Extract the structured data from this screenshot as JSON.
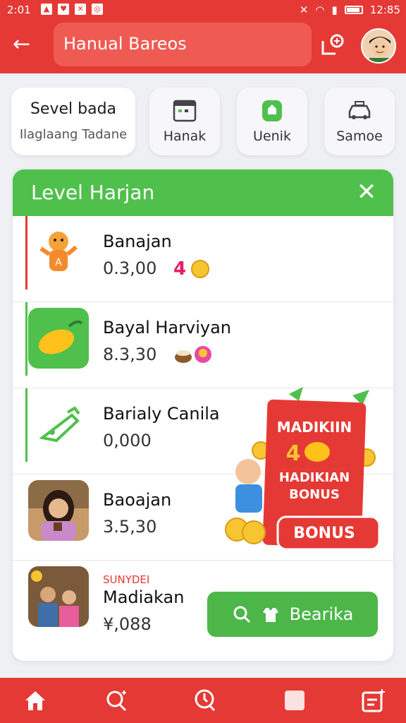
{
  "status": {
    "time_left": "2:01",
    "time_right": "12:85"
  },
  "header": {
    "search_text": "Hanual Bareos"
  },
  "categories": [
    {
      "title": "Sevel bada",
      "subtitle": "Ilaglaang Tadane"
    },
    {
      "label": "Hanak",
      "icon": "calendar-icon"
    },
    {
      "label": "Uenik",
      "icon": "shield-icon"
    },
    {
      "label": "Samoe",
      "icon": "taxi-icon"
    }
  ],
  "panel": {
    "title": "Level Harjan",
    "items": [
      {
        "name": "Banajan",
        "price": "0.3,00",
        "badge": "4",
        "accent": "#e53935"
      },
      {
        "name": "Bayal Harviyan",
        "price": "8.3,30",
        "accent": "#4fc04c"
      },
      {
        "name": "Barialy Canila",
        "price": "0,000",
        "accent": "#4fc04c"
      },
      {
        "name": "Baoajan",
        "price": "3.5,30"
      },
      {
        "tag": "SUNYDEI",
        "name": "Madiakan",
        "price": "¥,088"
      }
    ]
  },
  "promo": {
    "title": "MADIKIIN",
    "number": "4",
    "line1": "HADIKIAN",
    "line2": "BONUS",
    "button": "BONUS"
  },
  "cta": {
    "label": "Bearika"
  },
  "bottom_nav": [
    "home-icon",
    "search-icon",
    "history-icon",
    "square-icon",
    "notes-icon"
  ],
  "colors": {
    "brand_red": "#e53935",
    "brand_green": "#4fc04c"
  }
}
